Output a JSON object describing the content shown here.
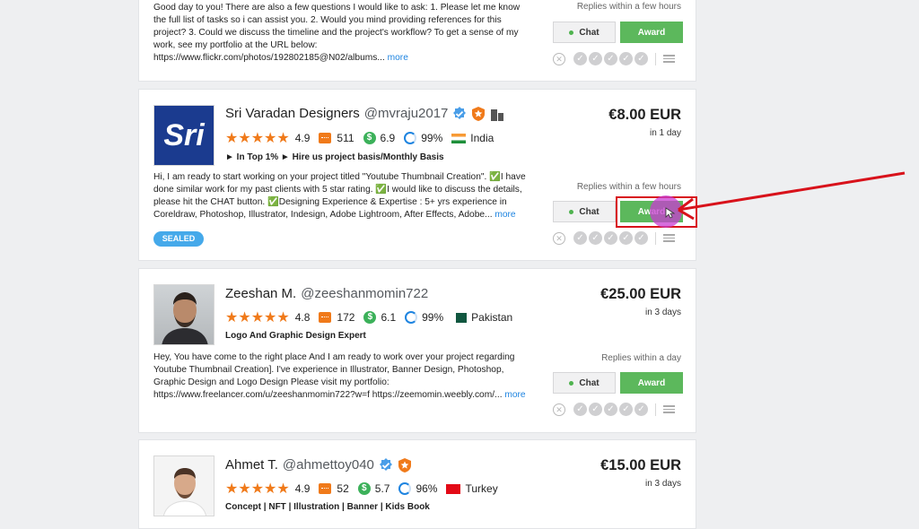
{
  "card0": {
    "desc": "Good day to you! There are also a few questions I would like to ask: 1. Please let me know the full list of tasks so i can assist you. 2. Would you mind providing references for this project? 3. Could we discuss the timeline and the project's workflow? To get a sense of my work, see my portfolio at the URL below: https://www.flickr.com/photos/192802185@N02/albums...",
    "more": "more",
    "reply": "Replies within a few hours",
    "chat": "Chat",
    "award": "Award"
  },
  "card1": {
    "name": "Sri Varadan Designers",
    "username": "@mvraju2017",
    "avatar_text": "Sri",
    "rating": "4.9",
    "reviews": "511",
    "earnings": "6.9",
    "completion": "99%",
    "country": "India",
    "tagline": "► In Top 1% ► Hire us project basis/Monthly Basis",
    "desc": "Hi, I am ready to start working on your project titled \"Youtube Thumbnail Creation\". ✅I have done similar work for my past clients with 5 star rating. ✅I would like to discuss the details, please hit the CHAT button. ✅Designing Experience & Expertise : 5+ yrs experience in Coreldraw, Photoshop, Illustrator, Indesign, Adobe Lightroom, After Effects, Adobe...",
    "more": "more",
    "sealed": "SEALED",
    "price": "€8.00 EUR",
    "delivery": "in 1 day",
    "reply": "Replies within a few hours",
    "chat": "Chat",
    "award": "Award"
  },
  "card2": {
    "name": "Zeeshan M.",
    "username": "@zeeshanmomin722",
    "rating": "4.8",
    "reviews": "172",
    "earnings": "6.1",
    "completion": "99%",
    "country": "Pakistan",
    "tagline": "Logo And Graphic Design Expert",
    "desc": "Hey, You have come to the right place And I am ready to work over your project regarding Youtube Thumbnail Creation]. I've experience in Illustrator, Banner Design, Photoshop, Graphic Design and Logo Design Please visit my portfolio: https://www.freelancer.com/u/zeeshanmomin722?w=f https://zeemomin.weebly.com/...",
    "more": "more",
    "price": "€25.00 EUR",
    "delivery": "in 3 days",
    "reply": "Replies within a day",
    "chat": "Chat",
    "award": "Award"
  },
  "card3": {
    "name": "Ahmet T.",
    "username": "@ahmettoy040",
    "rating": "4.9",
    "reviews": "52",
    "earnings": "5.7",
    "completion": "96%",
    "country": "Turkey",
    "tagline": "Concept | NFT | Illustration | Banner | Kids Book",
    "price": "€15.00 EUR",
    "delivery": "in 3 days"
  },
  "icons": {
    "star": "★★★★★",
    "check": "✓",
    "x": "✕",
    "dollar": "$"
  },
  "colors": {
    "accent": "#1e84e0",
    "award_green": "#5cb85c",
    "star_orange": "#f07a1a",
    "annotation_red": "#d8121b"
  }
}
